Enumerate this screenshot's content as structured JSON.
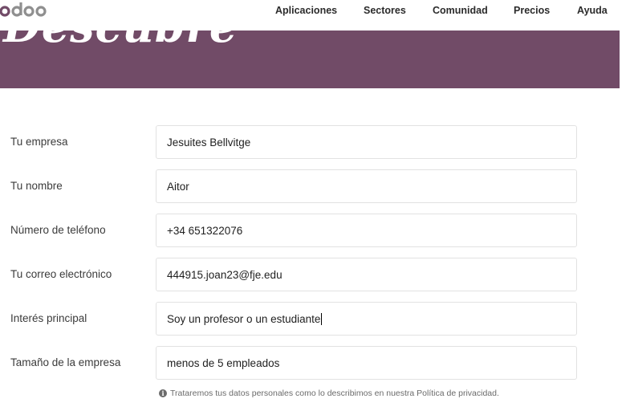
{
  "header": {
    "logo_text": "odoo",
    "nav": [
      "Aplicaciones",
      "Sectores",
      "Comunidad",
      "Precios",
      "Ayuda"
    ]
  },
  "hero": {
    "script_text": "Descubre"
  },
  "form": {
    "company_label": "Tu empresa",
    "company_value": "Jesuites Bellvitge",
    "name_label": "Tu nombre",
    "name_value": "Aitor",
    "phone_label": "Número de teléfono",
    "phone_value": "+34 651322076",
    "email_label": "Tu correo electrónico",
    "email_value": "444915.joan23@fje.edu",
    "interest_label": "Interés principal",
    "interest_value": "Soy un profesor o un estudiante",
    "size_label": "Tamaño de la empresa",
    "size_value": "menos de 5 empleados"
  },
  "privacy_notice": "Trataremos tus datos personales como lo describimos en nuestra Política de privacidad.",
  "colors": {
    "brand_purple": "#714b67",
    "logo_grey": "#8f8f8f"
  }
}
